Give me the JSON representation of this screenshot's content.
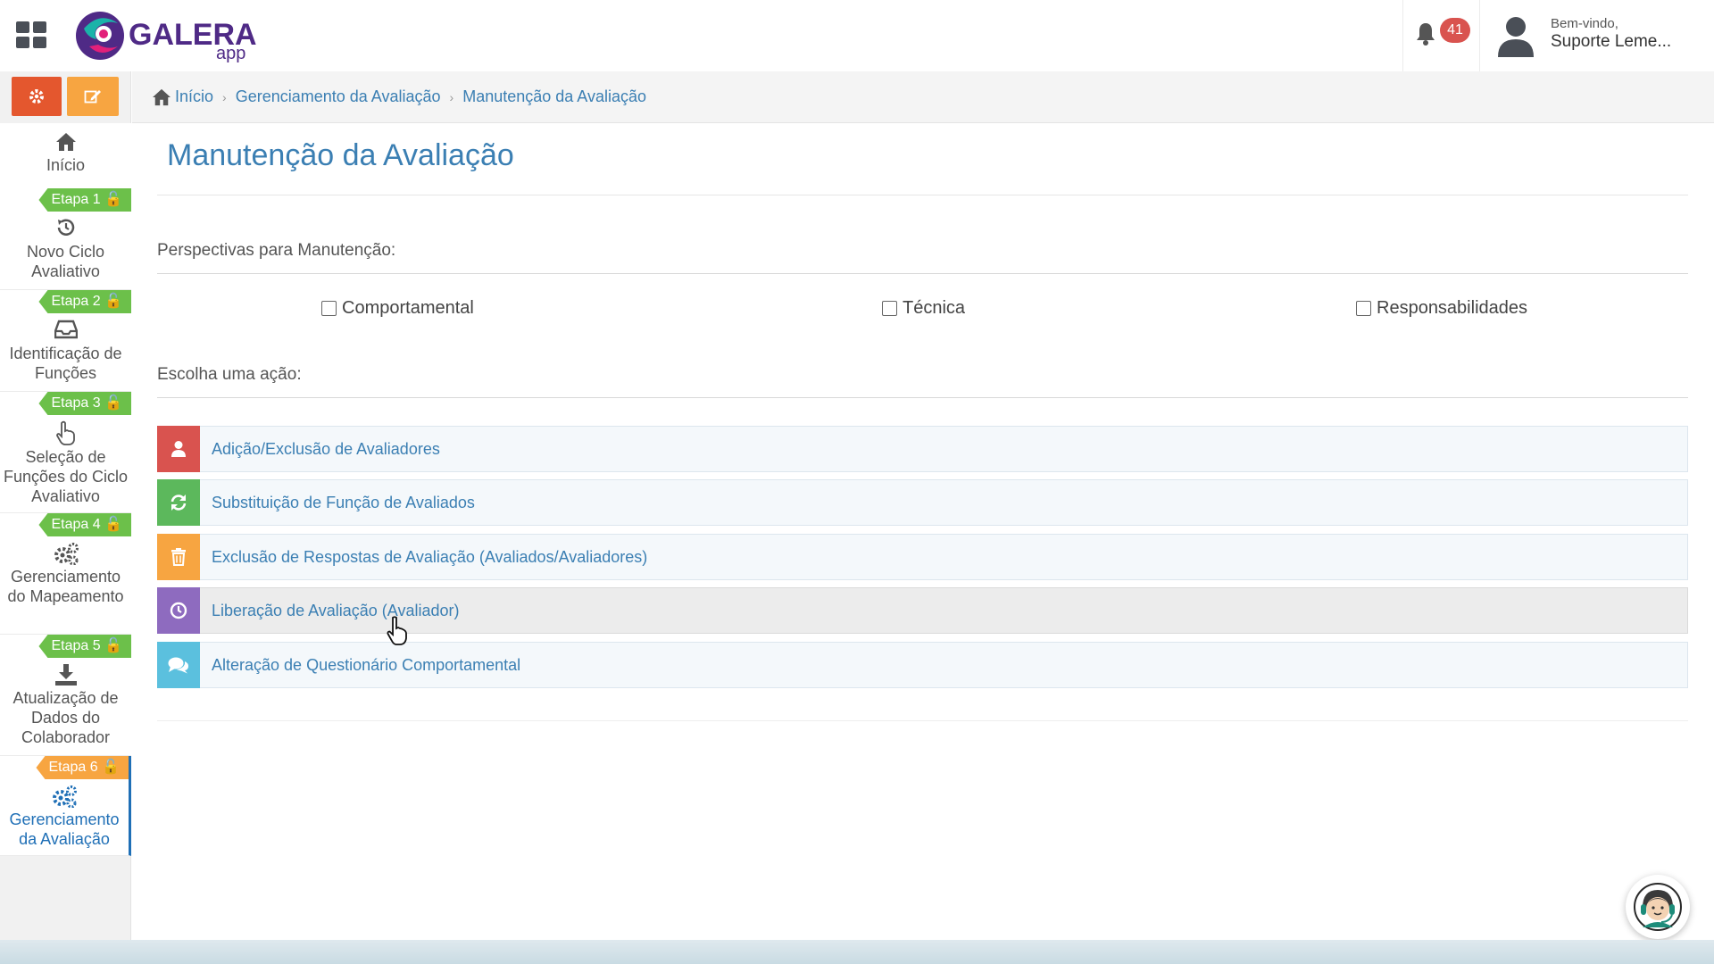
{
  "header": {
    "logo_text": "GALERA",
    "logo_sub": "app",
    "notification_count": "41",
    "greeting": "Bem-vindo,",
    "user_name": "Suporte Leme..."
  },
  "sidebar": {
    "items": [
      {
        "label": "Início",
        "icon": "home-icon"
      },
      {
        "etapa": "Etapa 1",
        "label": "Novo Ciclo Avaliativo",
        "icon": "history-icon"
      },
      {
        "etapa": "Etapa 2",
        "label": "Identificação de Funções",
        "icon": "inbox-icon"
      },
      {
        "etapa": "Etapa 3",
        "label": "Seleção de Funções do Ciclo Avaliativo",
        "icon": "hand-pointer-icon"
      },
      {
        "etapa": "Etapa 4",
        "label": "Gerenciamento do Mapeamento",
        "icon": "gears-icon"
      },
      {
        "etapa": "Etapa 5",
        "label": "Atualização de Dados do Colaborador",
        "icon": "download-icon"
      },
      {
        "etapa": "Etapa 6",
        "label": "Gerenciamento da Avaliação",
        "icon": "gears-icon",
        "active": true
      }
    ]
  },
  "breadcrumb": {
    "home": "Início",
    "level1": "Gerenciamento da Avaliação",
    "level2": "Manutenção da Avaliação"
  },
  "main": {
    "title": "Manutenção da Avaliação",
    "perspectives_label": "Perspectivas para Manutenção:",
    "perspectives": [
      "Comportamental",
      "Técnica",
      "Responsabilidades"
    ],
    "actions_label": "Escolha uma ação:",
    "actions": [
      {
        "label": "Adição/Exclusão de Avaliadores",
        "color": "#d9534f",
        "icon": "user-icon"
      },
      {
        "label": "Substituição de Função de Avaliados",
        "color": "#5cb85c",
        "icon": "refresh-icon"
      },
      {
        "label": "Exclusão de Respostas de Avaliação (Avaliados/Avaliadores)",
        "color": "#f7a541",
        "icon": "trash-icon"
      },
      {
        "label": "Liberação de Avaliação (Avaliador)",
        "color": "#8e6bbf",
        "icon": "clock-icon"
      },
      {
        "label": "Alteração de Questionário Comportamental",
        "color": "#5bc0de",
        "icon": "comments-icon"
      }
    ]
  }
}
